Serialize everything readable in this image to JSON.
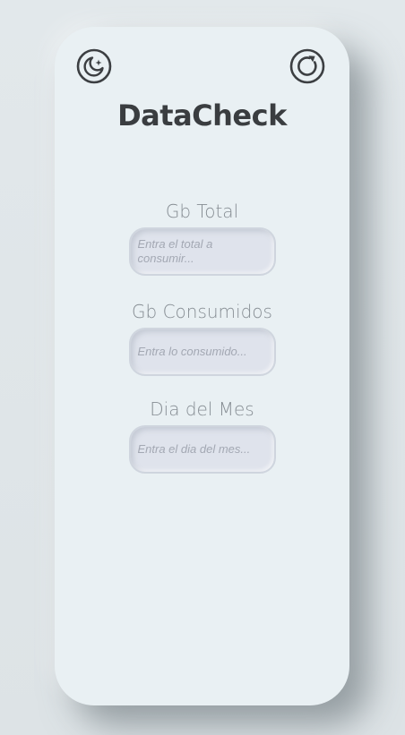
{
  "app": {
    "title": "DataCheck"
  },
  "header": {
    "theme_icon": "moon-icon",
    "refresh_icon": "refresh-icon"
  },
  "fields": [
    {
      "label": "Gb Total",
      "value": "",
      "placeholder": "Entra el total a consumir..."
    },
    {
      "label": "Gb Consumidos",
      "value": "",
      "placeholder": "Entra lo consumido..."
    },
    {
      "label": "Dia del Mes",
      "value": "",
      "placeholder": "Entra el dia del mes..."
    }
  ],
  "colors": {
    "background": "#dfe5e8",
    "card": "#e9f0f3",
    "title": "#3a3d40",
    "label": "#868d93",
    "input_bg": "#dfe3ec",
    "placeholder": "#a3a8b3"
  }
}
